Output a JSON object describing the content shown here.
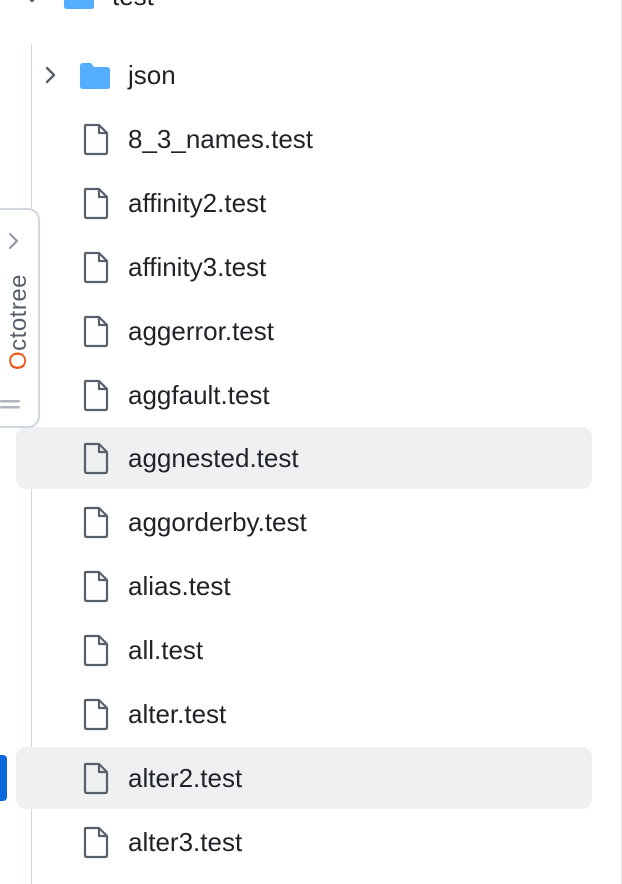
{
  "tree": {
    "root_folder": {
      "label": "test",
      "expanded": true
    },
    "items": [
      {
        "label": "json",
        "type": "folder",
        "expanded": false
      },
      {
        "label": "8_3_names.test",
        "type": "file"
      },
      {
        "label": "affinity2.test",
        "type": "file"
      },
      {
        "label": "affinity3.test",
        "type": "file"
      },
      {
        "label": "aggerror.test",
        "type": "file"
      },
      {
        "label": "aggfault.test",
        "type": "file"
      },
      {
        "label": "aggnested.test",
        "type": "file",
        "highlighted": true
      },
      {
        "label": "aggorderby.test",
        "type": "file"
      },
      {
        "label": "alias.test",
        "type": "file"
      },
      {
        "label": "all.test",
        "type": "file"
      },
      {
        "label": "alter.test",
        "type": "file"
      },
      {
        "label": "alter2.test",
        "type": "file",
        "highlighted": true
      },
      {
        "label": "alter3.test",
        "type": "file"
      }
    ]
  },
  "octotree_tab": {
    "label_first": "O",
    "label_rest": "ctotree"
  },
  "colors": {
    "folder": "#54aeff",
    "icon_stroke": "#57606a",
    "row_highlight": "#eef0f2",
    "accent": "#0969da",
    "octotree_orange": "#e8591a"
  }
}
